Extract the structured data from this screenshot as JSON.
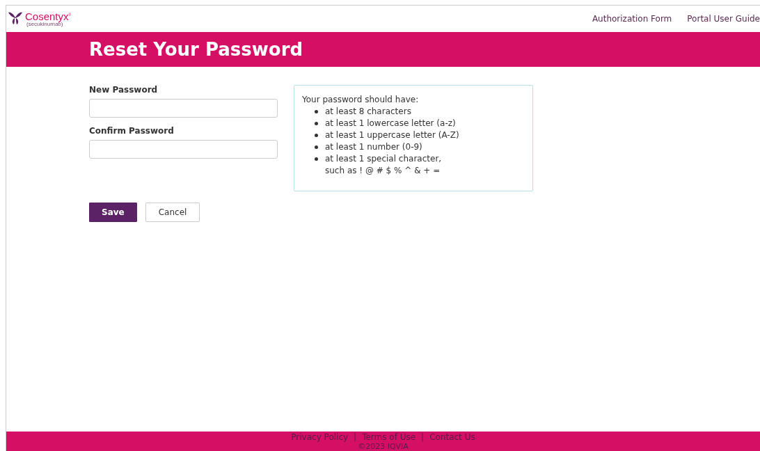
{
  "header": {
    "logo": {
      "name": "Cosentyx",
      "trademark": "®",
      "subtitle": "(secukinumab)"
    },
    "nav": [
      {
        "label": "Authorization Form"
      },
      {
        "label": "Portal User Guide"
      }
    ]
  },
  "banner": {
    "title": "Reset Your Password"
  },
  "form": {
    "fields": [
      {
        "label": "New Password"
      },
      {
        "label": "Confirm Password"
      }
    ],
    "buttons": [
      {
        "label": "Save",
        "kind": "primary"
      },
      {
        "label": "Cancel",
        "kind": "secondary"
      }
    ]
  },
  "requirements": {
    "heading": "Your password should have:",
    "items": [
      "at least 8 characters",
      "at least 1 lowercase letter (a-z)",
      "at least 1 uppercase letter (A-Z)",
      "at least 1 number (0-9)",
      "at least 1 special character,\nsuch as ! @ # $ % ^ & + ="
    ]
  },
  "footer": {
    "links": [
      "Privacy Policy",
      "Terms of Use",
      "Contact Us"
    ],
    "separator": "|",
    "copyright": "©2023 IQVIA"
  }
}
